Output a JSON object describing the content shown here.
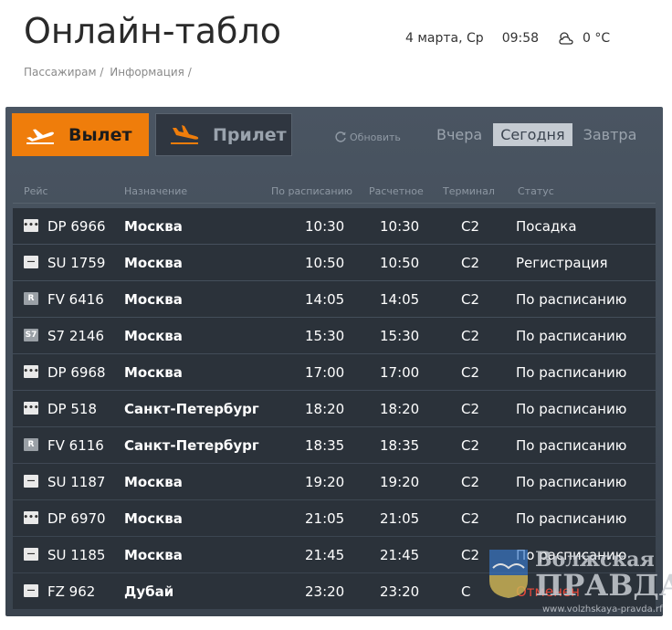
{
  "header": {
    "title": "Онлайн-табло",
    "date": "4 марта, Ср",
    "time": "09:58",
    "temperature": "0 °C",
    "weather_icon": "cloud-sun-icon"
  },
  "breadcrumbs": [
    "Пассажирам /",
    "Информация /"
  ],
  "tabs": {
    "departure": "Вылет",
    "arrival": "Прилет"
  },
  "refresh_label": "Обновить",
  "days": [
    "Вчера",
    "Сегодня",
    "Завтра"
  ],
  "active_day": "Сегодня",
  "columns": {
    "flight": "Рейс",
    "destination": "Назначение",
    "scheduled": "По расписанию",
    "estimated": "Расчетное",
    "terminal": "Терминал",
    "status": "Статус"
  },
  "flights": [
    {
      "flight": "DP 6966",
      "dest": "Москва",
      "sched": "10:30",
      "calc": "10:30",
      "term": "C2",
      "status": "Посадка"
    },
    {
      "flight": "SU 1759",
      "dest": "Москва",
      "sched": "10:50",
      "calc": "10:50",
      "term": "C2",
      "status": "Регистрация"
    },
    {
      "flight": "FV 6416",
      "dest": "Москва",
      "sched": "14:05",
      "calc": "14:05",
      "term": "C2",
      "status": "По расписанию"
    },
    {
      "flight": "S7 2146",
      "dest": "Москва",
      "sched": "15:30",
      "calc": "15:30",
      "term": "C2",
      "status": "По расписанию"
    },
    {
      "flight": "DP 6968",
      "dest": "Москва",
      "sched": "17:00",
      "calc": "17:00",
      "term": "C2",
      "status": "По расписанию"
    },
    {
      "flight": "DP 518",
      "dest": "Санкт-Петербург",
      "sched": "18:20",
      "calc": "18:20",
      "term": "C2",
      "status": "По расписанию"
    },
    {
      "flight": "FV 6116",
      "dest": "Санкт-Петербург",
      "sched": "18:35",
      "calc": "18:35",
      "term": "C2",
      "status": "По расписанию"
    },
    {
      "flight": "SU 1187",
      "dest": "Москва",
      "sched": "19:20",
      "calc": "19:20",
      "term": "C2",
      "status": "По расписанию"
    },
    {
      "flight": "DP 6970",
      "dest": "Москва",
      "sched": "21:05",
      "calc": "21:05",
      "term": "C2",
      "status": "По расписанию"
    },
    {
      "flight": "SU 1185",
      "dest": "Москва",
      "sched": "21:45",
      "calc": "21:45",
      "term": "C2",
      "status": "По расписанию"
    },
    {
      "flight": "FZ 962",
      "dest": "Дубай",
      "sched": "23:20",
      "calc": "23:20",
      "term": "C",
      "status": "Отменен"
    }
  ],
  "watermark": {
    "line1": "Волжская",
    "line2": "ПРАВДА",
    "line3": "www.volzhskaya-pravda.rf"
  },
  "colors": {
    "accent": "#ef7d0b",
    "board": "#3f4853",
    "row": "#2b323a",
    "cancel": "#e94a3a"
  }
}
